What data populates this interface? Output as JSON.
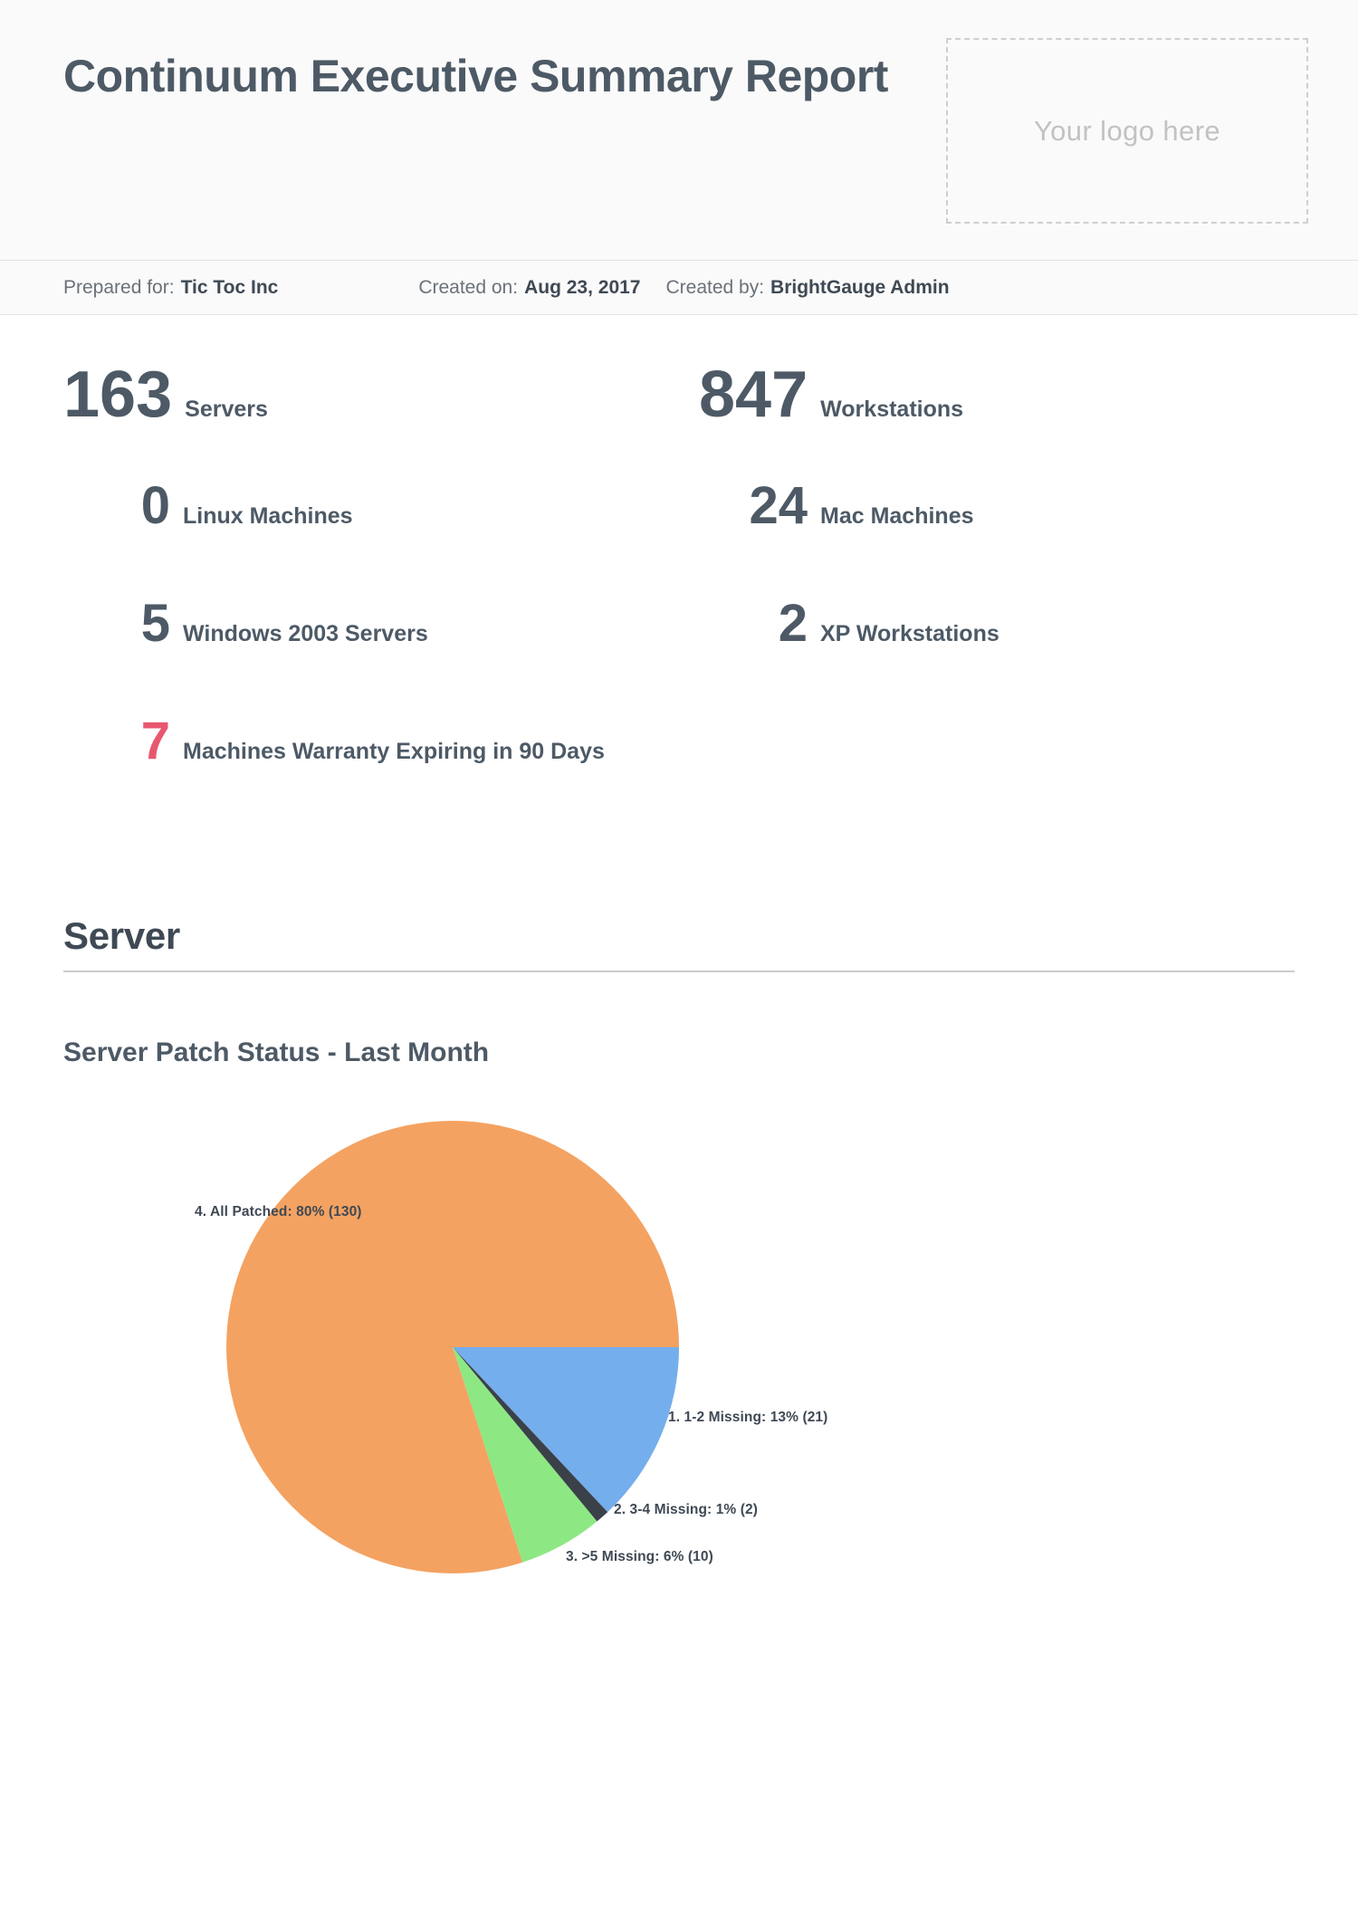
{
  "header": {
    "title": "Continuum Executive Summary Report",
    "logo_placeholder": "Your logo here"
  },
  "meta": {
    "prepared_for_label": "Prepared for:",
    "prepared_for_value": "Tic Toc Inc",
    "created_on_label": "Created on:",
    "created_on_value": "Aug 23, 2017",
    "created_by_label": "Created by:",
    "created_by_value": "BrightGauge Admin"
  },
  "metrics": [
    {
      "value": "163",
      "label": "Servers",
      "size": "big",
      "accent": "default"
    },
    {
      "value": "847",
      "label": "Workstations",
      "size": "big",
      "accent": "default"
    },
    {
      "value": "0",
      "label": "Linux Machines",
      "size": "mid",
      "accent": "default"
    },
    {
      "value": "24",
      "label": "Mac Machines",
      "size": "mid",
      "accent": "default"
    },
    {
      "value": "5",
      "label": "Windows 2003 Servers",
      "size": "mid",
      "accent": "default"
    },
    {
      "value": "2",
      "label": "XP Workstations",
      "size": "mid",
      "accent": "default"
    },
    {
      "value": "7",
      "label": "Machines Warranty Expiring in 90 Days",
      "size": "mid",
      "accent": "alert"
    }
  ],
  "section": {
    "title": "Server"
  },
  "widget": {
    "title": "Server Patch Status - Last Month"
  },
  "colors": {
    "text_dark": "#4d5a66",
    "text_muted": "#6a7179",
    "alert_red": "#e8576f",
    "slice_blue": "#75aeec",
    "slice_dark": "#3b4149",
    "slice_green": "#8de884",
    "slice_orange": "#f4a261",
    "band_bg": "#fafafa",
    "rule": "#cccccc"
  },
  "chart_data": {
    "type": "pie",
    "title": "Server Patch Status - Last Month",
    "legend_position": "callout-labels",
    "start_angle_deg": 0,
    "direction": "clockwise",
    "total": 163,
    "categories": [
      "1. 1-2 Missing",
      "2. 3-4 Missing",
      "3. >5 Missing",
      "4. All Patched"
    ],
    "values": [
      21,
      2,
      10,
      130
    ],
    "percents": [
      13,
      1,
      6,
      80
    ],
    "colors": [
      "#75aeec",
      "#3b4149",
      "#8de884",
      "#f4a261"
    ],
    "labels": [
      "1. 1-2 Missing: 13% (21)",
      "2. 3-4 Missing: 1% (2)",
      "3. >5 Missing: 6% (10)",
      "4. All Patched: 80% (130)"
    ]
  }
}
